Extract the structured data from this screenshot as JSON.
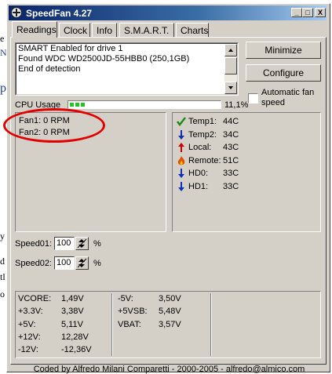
{
  "background": {
    "fragments": [
      "e",
      "N",
      "p",
      "y",
      "d",
      "tl",
      "o"
    ]
  },
  "window": {
    "title": "SpeedFan 4.27",
    "controls": {
      "minimize": "_",
      "maximize": "□",
      "close": "X"
    }
  },
  "tabs": [
    {
      "label": "Readings",
      "active": true
    },
    {
      "label": "Clock",
      "active": false
    },
    {
      "label": "Info",
      "active": false
    },
    {
      "label": "S.M.A.R.T.",
      "active": false
    },
    {
      "label": "Charts",
      "active": false
    }
  ],
  "log": {
    "lines": "SMART Enabled for drive 1\nFound WDC WD2500JD-55HBB0 (250,1GB)\nEnd of detection"
  },
  "buttons": {
    "minimize": "Minimize",
    "configure": "Configure"
  },
  "auto_fan": {
    "label_1": "Automatic fan",
    "label_2": "speed",
    "checked": false
  },
  "cpu_usage": {
    "label": "CPU Usage",
    "value": "11,1%",
    "fraction": 0.111
  },
  "fans": [
    {
      "label": "Fan1: 0 RPM"
    },
    {
      "label": "Fan2: 0 RPM"
    }
  ],
  "temps": [
    {
      "name": "Temp1:",
      "value": "44C",
      "icon": "check-icon",
      "color": "#1a8a1a"
    },
    {
      "name": "Temp2:",
      "value": "34C",
      "icon": "arrow-down-icon",
      "color": "#1030c0"
    },
    {
      "name": "Local:",
      "value": "43C",
      "icon": "arrow-up-icon",
      "color": "#d00000"
    },
    {
      "name": "Remote:",
      "value": "51C",
      "icon": "flame-icon",
      "color": "#e05000"
    },
    {
      "name": "HD0:",
      "value": "33C",
      "icon": "arrow-down-icon",
      "color": "#1030c0"
    },
    {
      "name": "HD1:",
      "value": "33C",
      "icon": "arrow-down-icon",
      "color": "#1030c0"
    }
  ],
  "speeds": [
    {
      "label": "Speed01:",
      "value": "100",
      "unit": "%"
    },
    {
      "label": "Speed02:",
      "value": "100",
      "unit": "%"
    }
  ],
  "voltages": {
    "col1": [
      {
        "name": "VCORE:",
        "value": "1,49V"
      },
      {
        "name": "+3.3V:",
        "value": "3,38V"
      },
      {
        "name": "+5V:",
        "value": "5,11V"
      },
      {
        "name": "+12V:",
        "value": "12,28V"
      },
      {
        "name": "-12V:",
        "value": "-12,36V"
      }
    ],
    "col2": [
      {
        "name": "-5V:",
        "value": "3,50V"
      },
      {
        "name": "+5VSB:",
        "value": "5,48V"
      },
      {
        "name": "VBAT:",
        "value": "3,57V"
      }
    ]
  },
  "footer": "Coded by Alfredo Milani Comparetti - 2000-2005 - alfredo@almico.com",
  "colors": {
    "highlight_ellipse": "#e20000",
    "progress": "#1ec81e"
  }
}
